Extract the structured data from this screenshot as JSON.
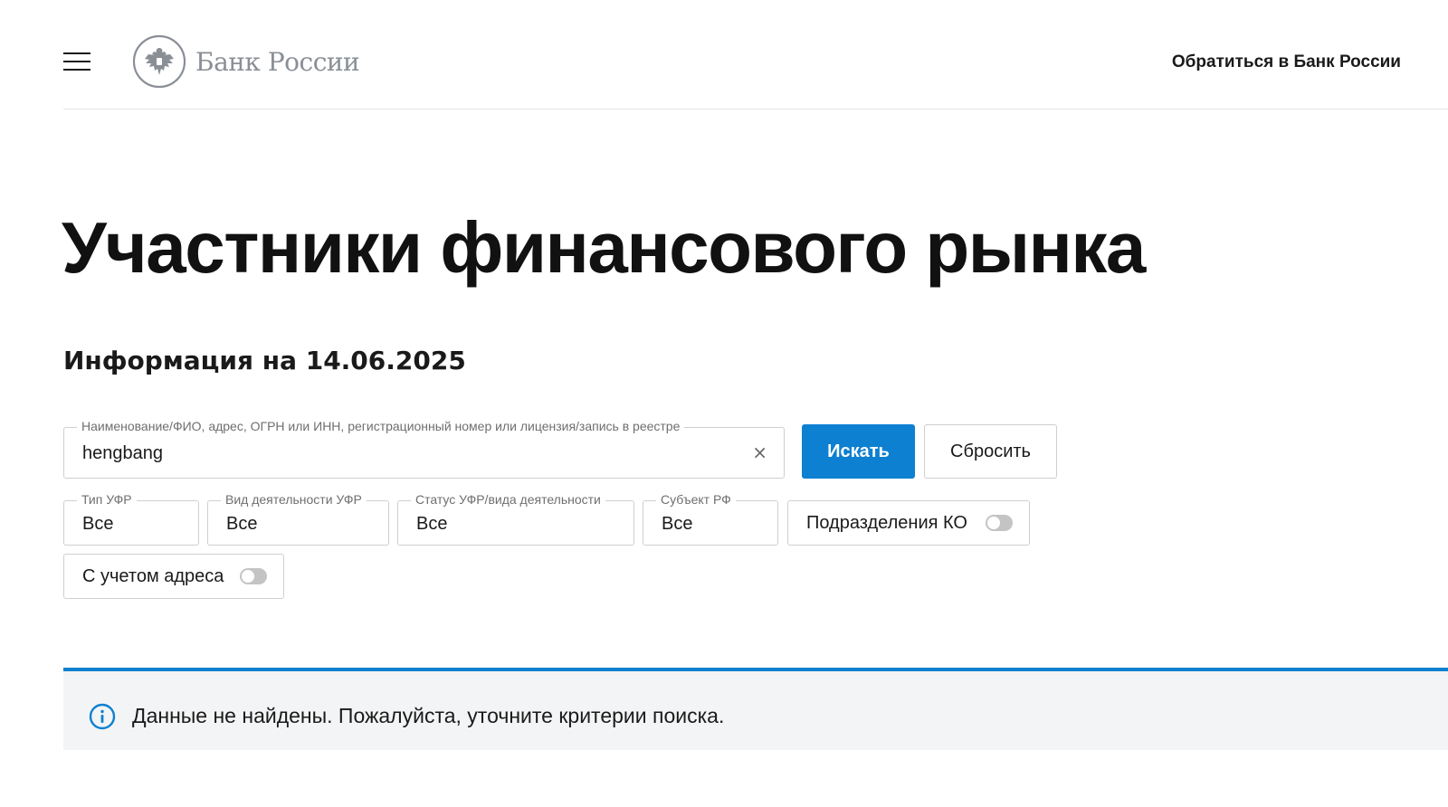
{
  "header": {
    "logo_text": "Банк России",
    "contact_link": "Обратиться в Банк России"
  },
  "page": {
    "title": "Участники финансового рынка",
    "info_date": "Информация на 14.06.2025"
  },
  "search": {
    "label": "Наименование/ФИО, адрес, ОГРН или ИНН, регистрационный номер или лицензия/запись в реестре",
    "value": "hengbang",
    "clear_symbol": "×",
    "search_button": "Искать",
    "reset_button": "Сбросить"
  },
  "filters": {
    "type": {
      "label": "Тип УФР",
      "value": "Все"
    },
    "activity": {
      "label": "Вид деятельности УФР",
      "value": "Все"
    },
    "status": {
      "label": "Статус УФР/вида деятельности",
      "value": "Все"
    },
    "region": {
      "label": "Субъект РФ",
      "value": "Все"
    },
    "branches_toggle": {
      "label": "Подразделения КО",
      "on": false
    },
    "address_toggle": {
      "label": "С учетом адреса",
      "on": false
    }
  },
  "notice": {
    "text": "Данные не найдены. Пожалуйста, уточните критерии поиска.",
    "icon": "info-icon"
  },
  "colors": {
    "accent": "#0d80d1",
    "notice_bg": "#f3f4f5",
    "logo_gray": "#8a8f96"
  }
}
